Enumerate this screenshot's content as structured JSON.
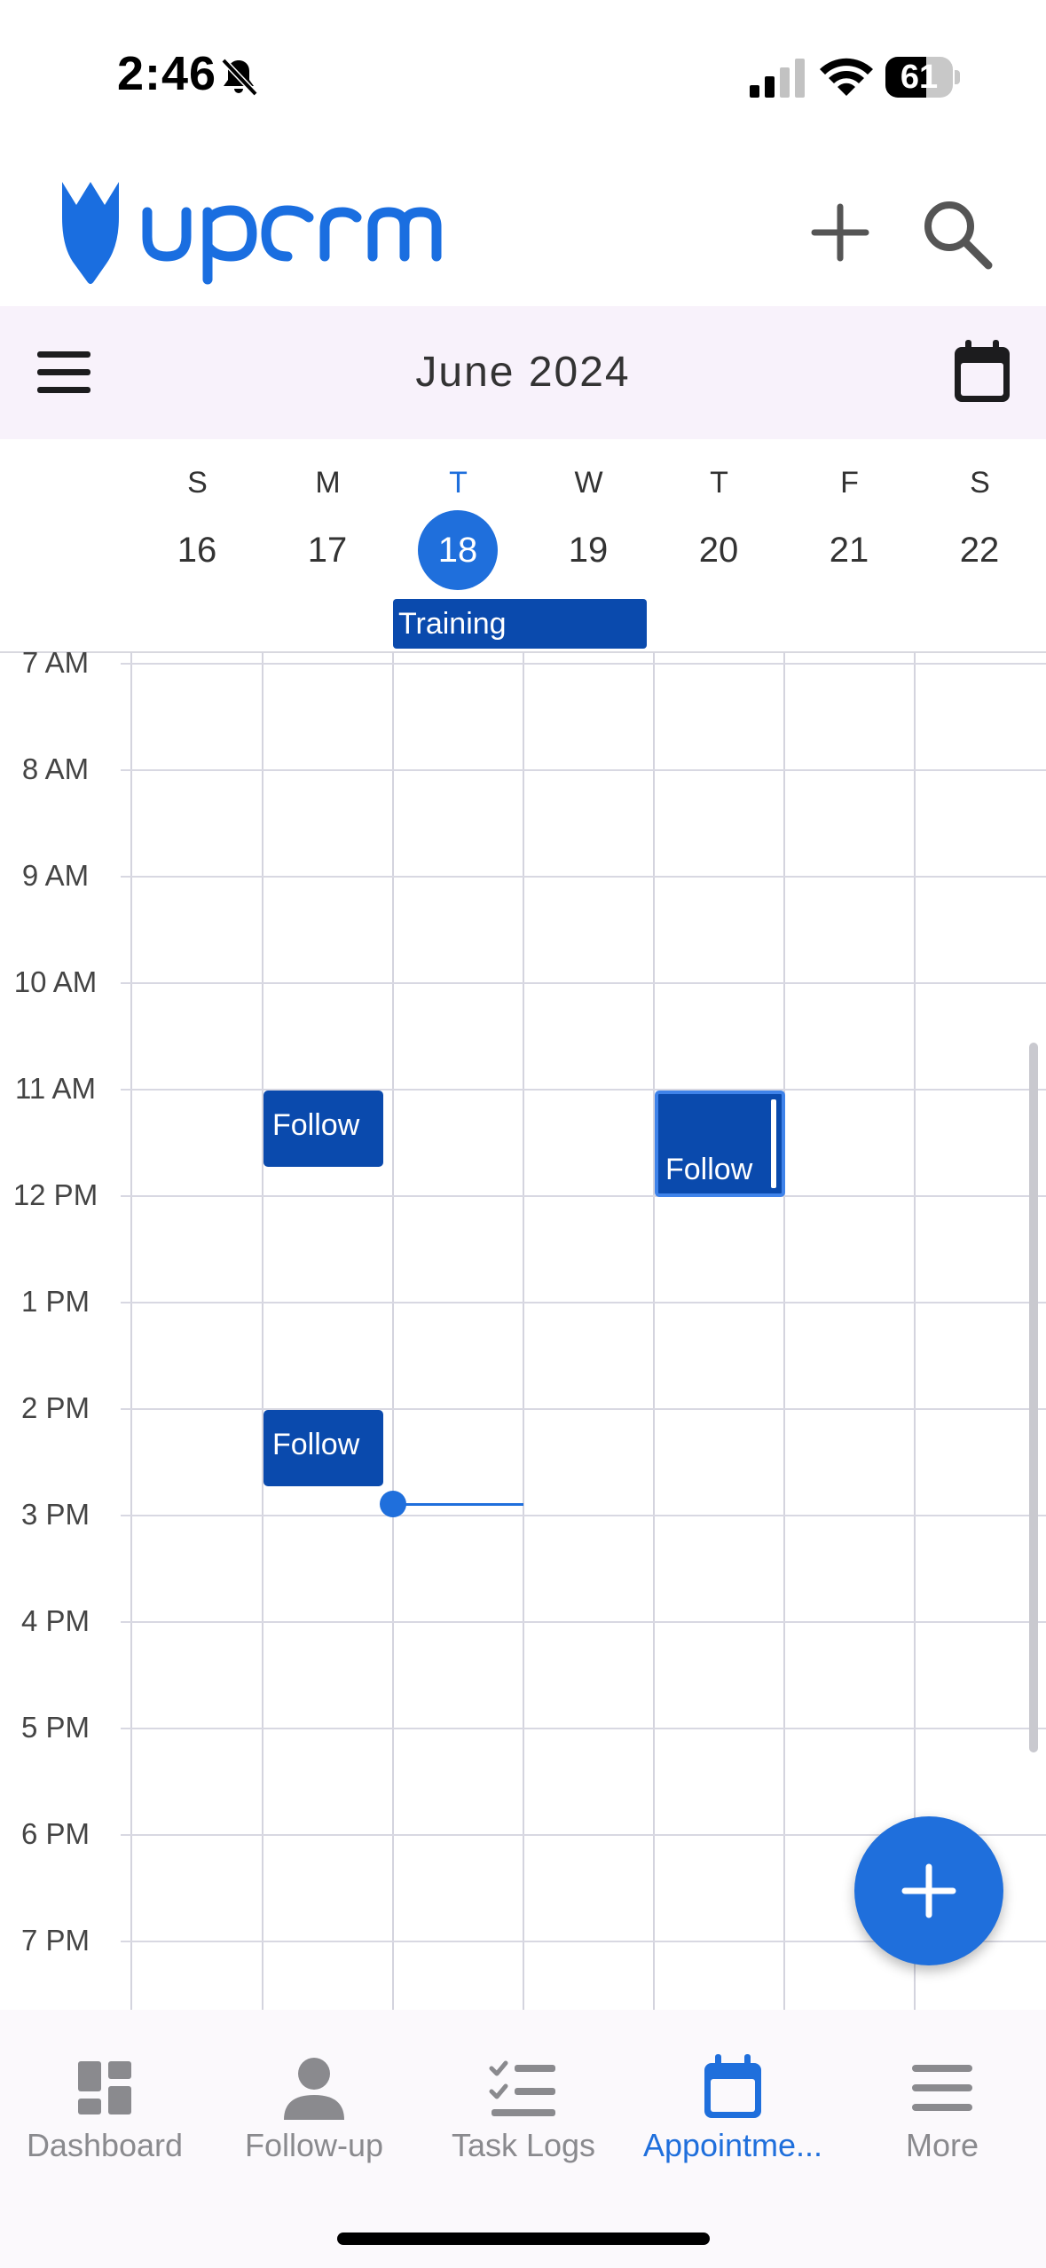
{
  "status_bar": {
    "time": "2:46",
    "battery": "61",
    "battery_level": 0.61
  },
  "toolbar": {
    "month_title": "June 2024"
  },
  "week": {
    "days": [
      {
        "letter": "S",
        "date": "16"
      },
      {
        "letter": "M",
        "date": "17"
      },
      {
        "letter": "T",
        "date": "18",
        "today": true
      },
      {
        "letter": "W",
        "date": "19"
      },
      {
        "letter": "T",
        "date": "20"
      },
      {
        "letter": "F",
        "date": "21"
      },
      {
        "letter": "S",
        "date": "22"
      }
    ],
    "all_day_event": "Training"
  },
  "grid": {
    "hours": [
      "7 AM",
      "8 AM",
      "9 AM",
      "10 AM",
      "11 AM",
      "12 PM",
      "1 PM",
      "2 PM",
      "3 PM",
      "4 PM",
      "5 PM",
      "6 PM",
      "7 PM"
    ],
    "events": [
      {
        "label": "Follow"
      },
      {
        "label": "Follow"
      },
      {
        "label": "Follow\n-up"
      }
    ]
  },
  "nav": {
    "items": [
      {
        "label": "Dashboard",
        "icon": "dashboard-icon"
      },
      {
        "label": "Follow-up",
        "icon": "person-icon"
      },
      {
        "label": "Task Logs",
        "icon": "checklist-icon"
      },
      {
        "label": "Appointme...",
        "icon": "calendar-icon",
        "active": true
      },
      {
        "label": "More",
        "icon": "menu-icon"
      }
    ]
  },
  "colors": {
    "accent": "#1f6fdc",
    "event": "#0a4aad",
    "toolbar_bg": "#f8f2fb"
  }
}
